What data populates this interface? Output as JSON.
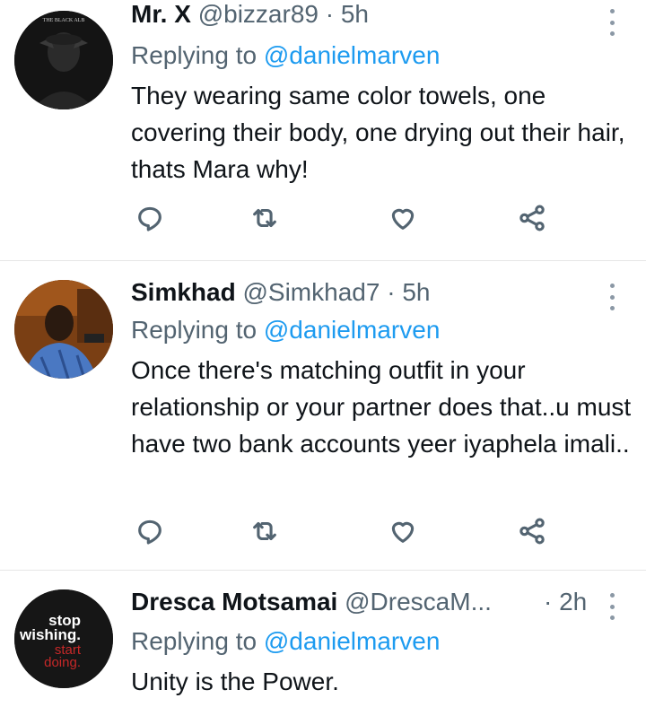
{
  "tweets": [
    {
      "name": "Mr. X",
      "handle": "@bizzar89",
      "dot": "·",
      "time": "5h",
      "replying_prefix": "Replying to",
      "replying_to": "@danielmarven",
      "body": "They wearing same color towels, one covering their body, one drying out their hair, thats Mara why!",
      "avatar_text": "THE BLACK ALB"
    },
    {
      "name": "Simkhad",
      "handle": "@Simkhad7",
      "dot": "·",
      "time": "5h",
      "replying_prefix": "Replying to",
      "replying_to": "@danielmarven",
      "body": "Once there's matching outfit in your relationship or your partner does that..u must have two bank accounts yeer iyaphela imali.."
    },
    {
      "name": "Dresca Motsamai",
      "handle": "@DrescaM...",
      "dot": "·",
      "time": "2h",
      "replying_prefix": "Replying to",
      "replying_to": "@danielmarven",
      "body": "Unity is the Power.",
      "avatar_lines": [
        "stop",
        "wishing.",
        "start",
        "doing."
      ]
    }
  ],
  "icons": [
    "reply-icon",
    "retweet-icon",
    "like-icon",
    "share-icon",
    "more-icon"
  ],
  "colors": {
    "mention": "#1d9bf0",
    "secondary": "#536471",
    "avatar3_red": "#c62828"
  }
}
